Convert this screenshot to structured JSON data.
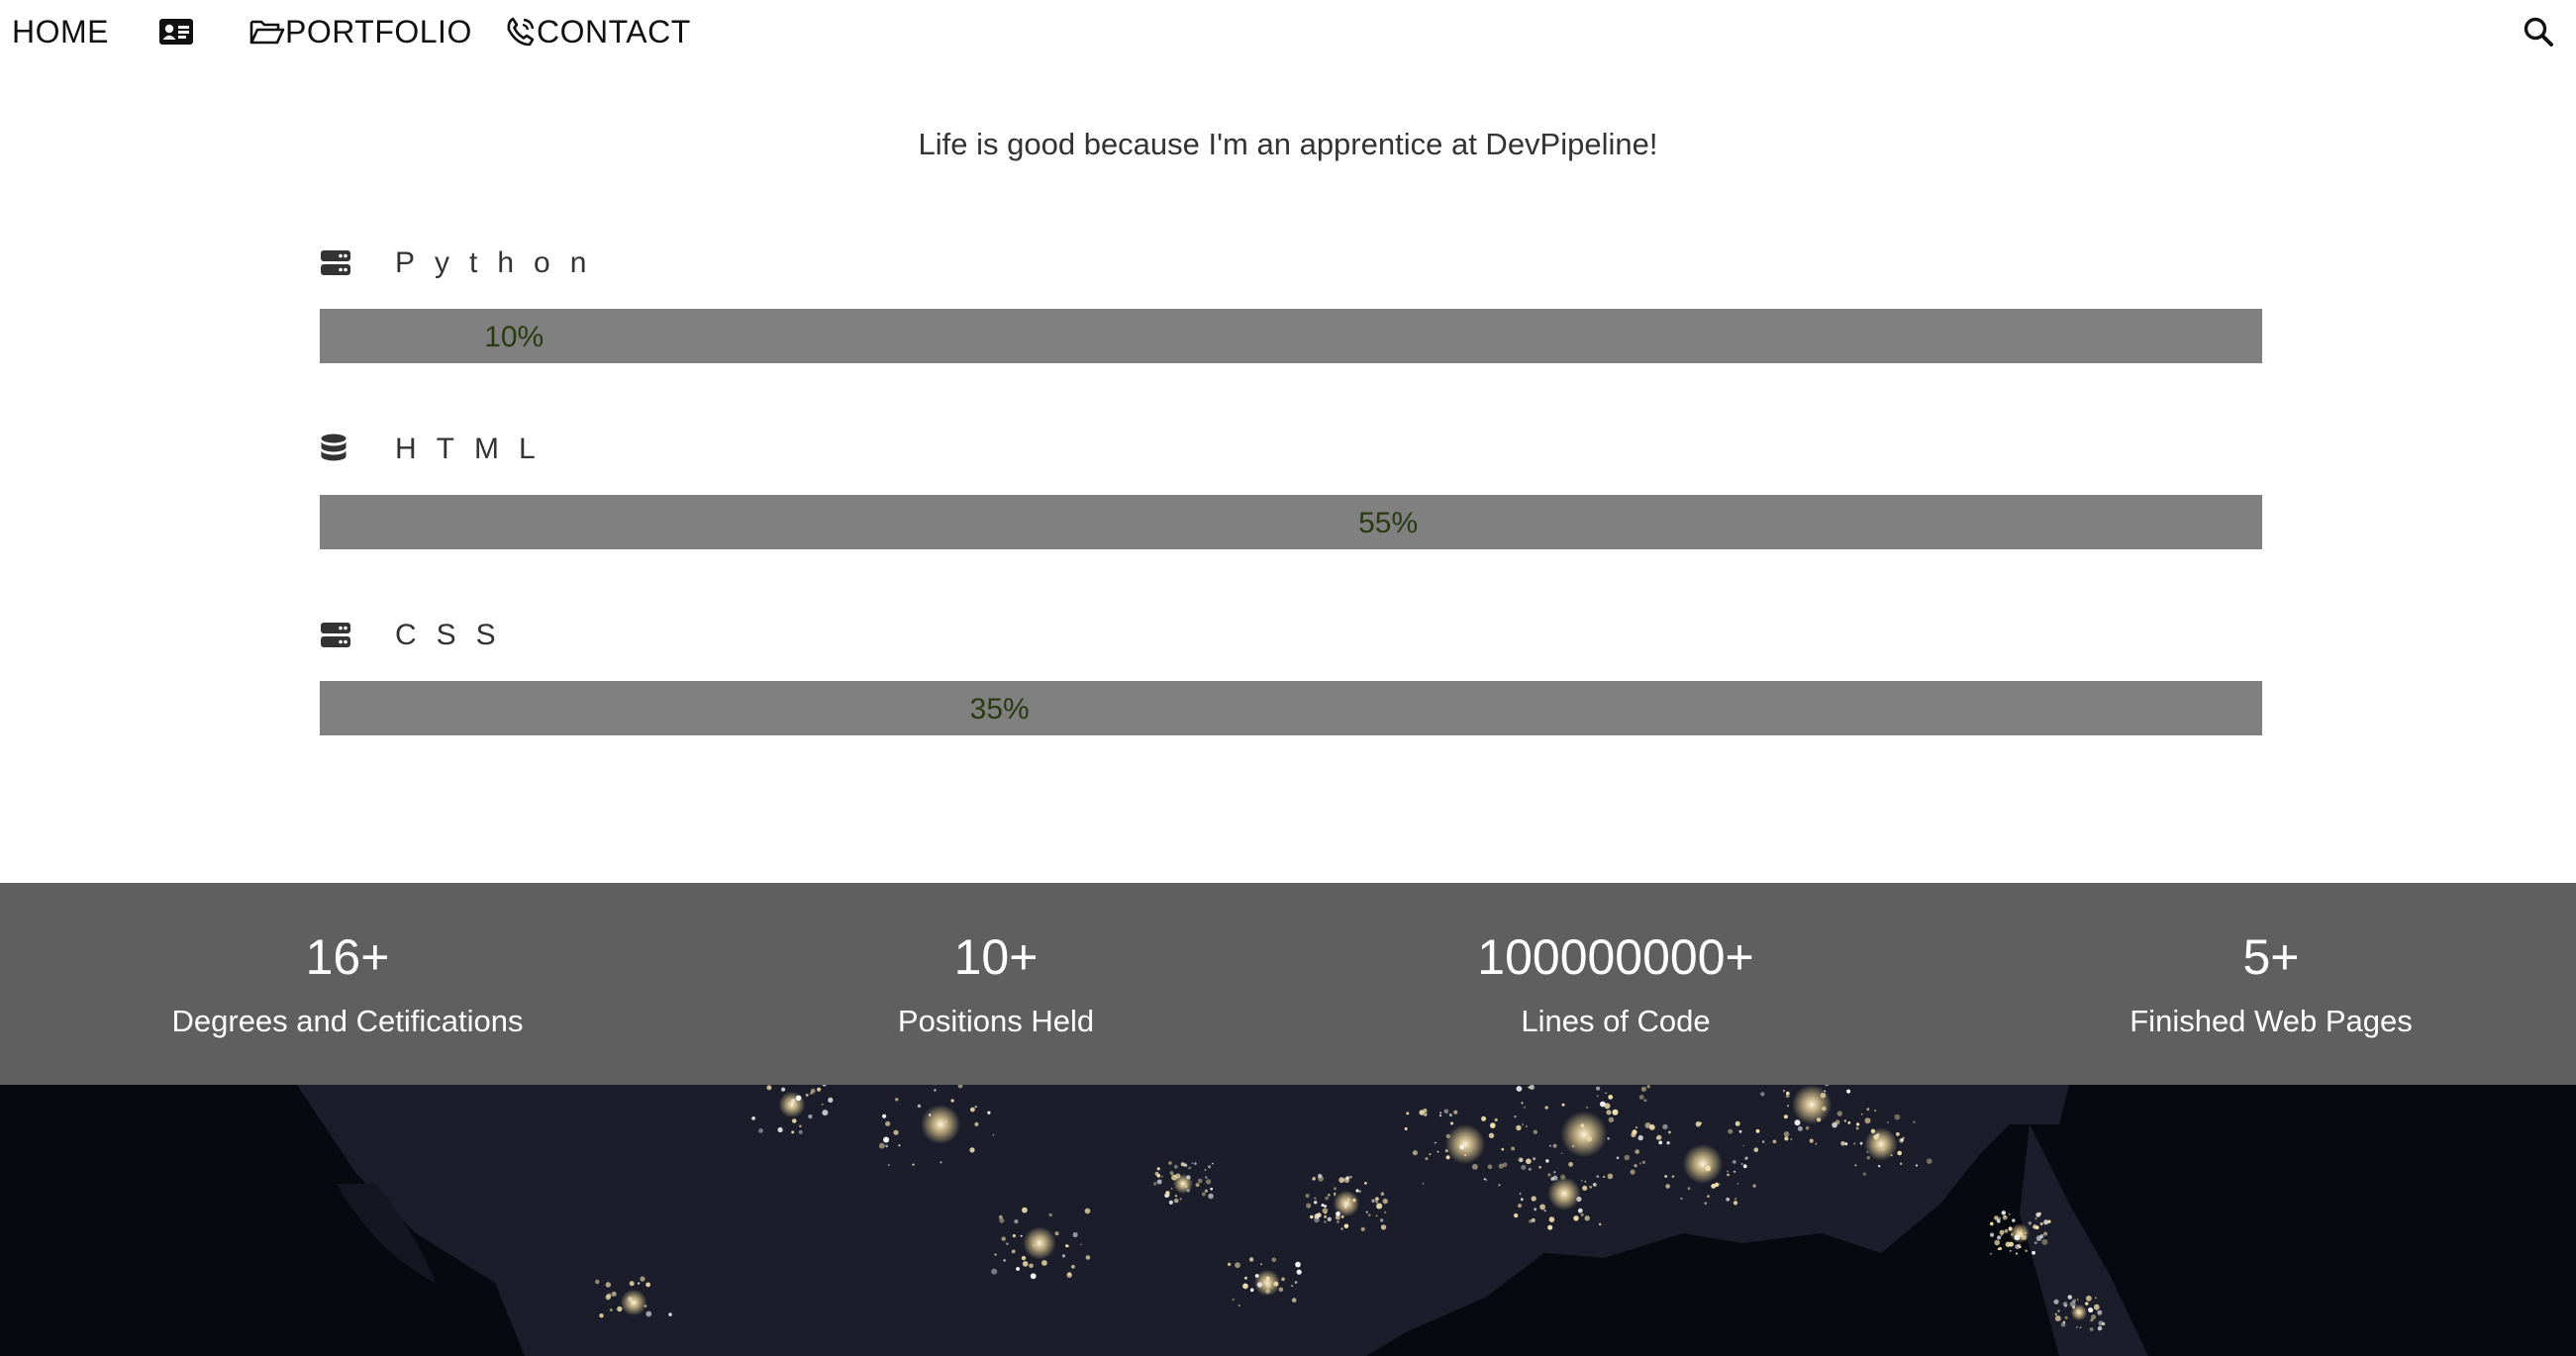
{
  "nav": {
    "home_label": "HOME",
    "about_icon": "id-card-icon",
    "portfolio_icon": "folder-open-icon",
    "portfolio_label": "PORTFOLIO",
    "contact_icon": "phone-icon",
    "contact_label": "CONTACT",
    "search_icon": "search-icon"
  },
  "tagline": "Life is good because I'm an apprentice at DevPipeline!",
  "skills": [
    {
      "name": "Python",
      "icon": "server-icon",
      "percent_label": "10%",
      "percent": 10
    },
    {
      "name": "HTML",
      "icon": "database-icon",
      "percent_label": "55%",
      "percent": 55
    },
    {
      "name": "CSS",
      "icon": "server-icon",
      "percent_label": "35%",
      "percent": 35
    }
  ],
  "stats": [
    {
      "value": "16+",
      "label": "Degrees and Cetifications"
    },
    {
      "value": "10+",
      "label": "Positions Held"
    },
    {
      "value": "100000000+",
      "label": "Lines of Code"
    },
    {
      "value": "5+",
      "label": "Finished Web Pages"
    }
  ],
  "colors": {
    "bar": "#808080",
    "percent_text": "#2a3a12",
    "stats_band": "#5f5f5f",
    "night_bg": "#070910"
  },
  "hero_image": "night-city-lights-map-image"
}
